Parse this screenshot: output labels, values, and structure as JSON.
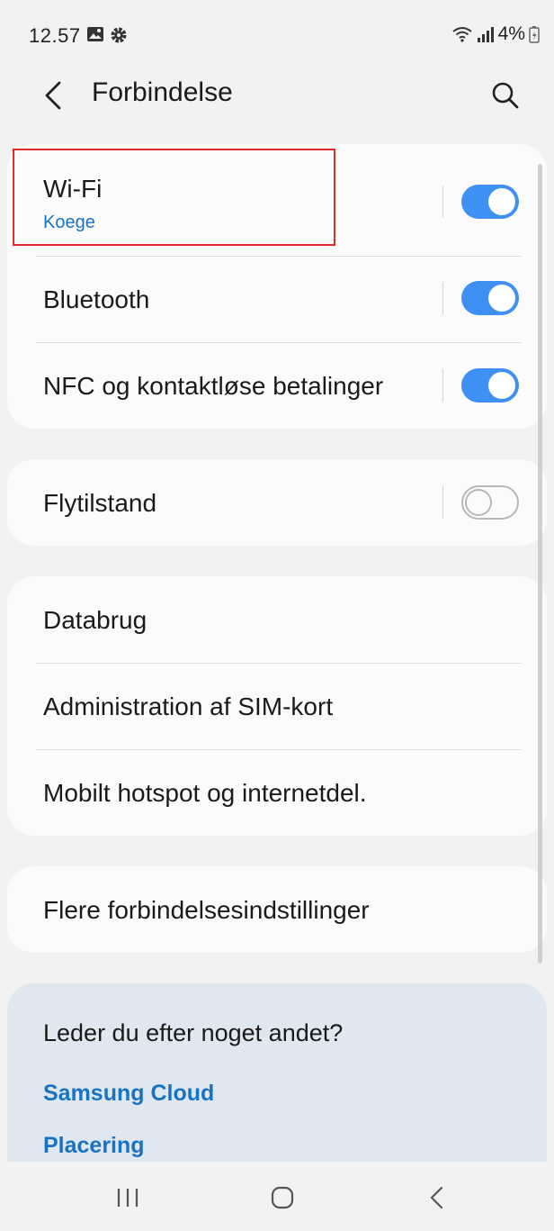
{
  "status_bar": {
    "time": "12.57",
    "battery": "4%",
    "icons": [
      "gallery-icon",
      "settings-gear-icon",
      "wifi-signal-icon",
      "cell-signal-icon",
      "battery-charging-icon"
    ]
  },
  "header": {
    "title": "Forbindelse",
    "back_icon": "chevron-left-icon",
    "search_icon": "search-icon"
  },
  "group1": [
    {
      "label": "Wi-Fi",
      "sublabel": "Koege",
      "toggle": true
    },
    {
      "label": "Bluetooth",
      "toggle": true
    },
    {
      "label": "NFC og kontaktløse betalinger",
      "toggle": true
    }
  ],
  "group2": [
    {
      "label": "Flytilstand",
      "toggle": false
    }
  ],
  "group3": [
    {
      "label": "Databrug"
    },
    {
      "label": "Administration af SIM-kort"
    },
    {
      "label": "Mobilt hotspot og internetdel."
    }
  ],
  "group4": [
    {
      "label": "Flere forbindelsesindstillinger"
    }
  ],
  "suggestions": {
    "title": "Leder du efter noget andet?",
    "links": [
      "Samsung Cloud",
      "Placering"
    ]
  },
  "nav_bar": {
    "icons": [
      "recent-apps-icon",
      "home-icon",
      "back-nav-icon"
    ]
  },
  "colors": {
    "accent": "#3e91f2",
    "link": "#1a73c2",
    "highlight": "#e32b2b",
    "background": "#f2f2f2",
    "card": "#fbfbfb",
    "suggest_bg": "#dfe8f1"
  }
}
